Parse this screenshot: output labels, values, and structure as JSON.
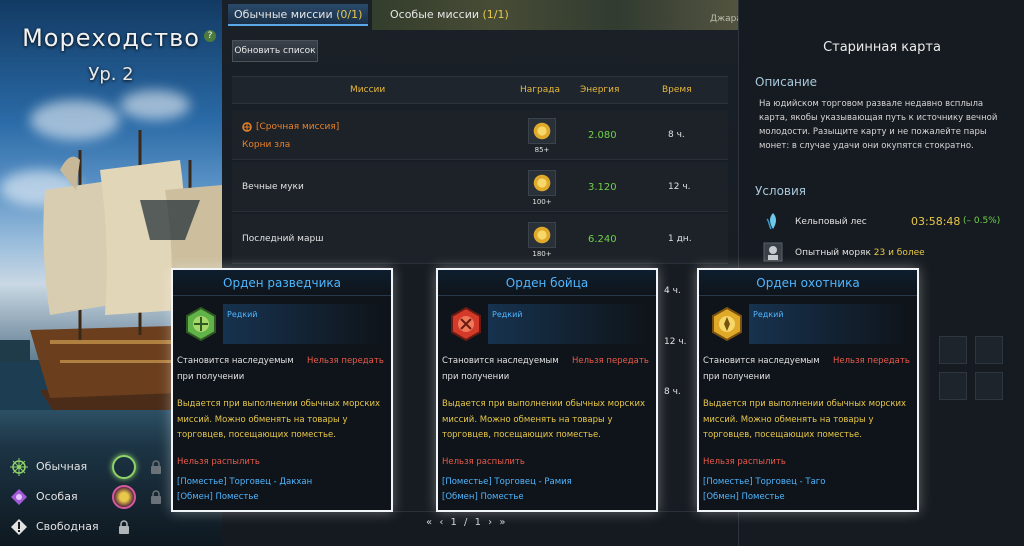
{
  "left": {
    "title": "Мореходство",
    "help": "?",
    "level": "Ур. 2",
    "modes": [
      {
        "label": "Обычная"
      },
      {
        "label": "Особая"
      },
      {
        "label": "Свободная"
      }
    ]
  },
  "tabs": [
    {
      "label": "Обычные миссии",
      "count": "(0/1)"
    },
    {
      "label": "Особые миссии",
      "count": "(1/1)"
    }
  ],
  "toolbar": {
    "refresh_label": "Обновить список"
  },
  "table": {
    "headers": [
      "Миссии",
      "Награда",
      "Энергия",
      "Время"
    ],
    "rows": [
      {
        "tag": "[Срочная миссия]",
        "name": "Корни зла",
        "reward_count": "85+",
        "energy": "2.080",
        "time": "8 ч."
      },
      {
        "tag": "",
        "name": "Вечные муки",
        "reward_count": "100+",
        "energy": "3.120",
        "time": "12 ч."
      },
      {
        "tag": "",
        "name": "Последний марш",
        "reward_count": "180+",
        "energy": "6.240",
        "time": "1 дн."
      }
    ],
    "hidden_times": [
      "4 ч.",
      "12 ч.",
      "8 ч."
    ]
  },
  "map_fragment": "Джарагай",
  "pager": {
    "page": "1 / 1",
    "first": "«",
    "prev": "‹",
    "next": "›",
    "last": "»"
  },
  "right": {
    "title": "Старинная карта",
    "desc_header": "Описание",
    "description": "На юдийском торговом развале недавно всплыла карта, якобы указывающая путь к источнику вечной молодости. Разыщите карту и не пожалейте пары монет: в случае удачи они окупятся стократно.",
    "cond_header": "Условия",
    "conditions": [
      {
        "label": "Кельповый лес",
        "timer": "03:58:48",
        "pct": "(– 0.5%)"
      },
      {
        "label": "Опытный моряк",
        "value": "23 и более"
      }
    ]
  },
  "tooltips": [
    {
      "title": "Орден разведчика",
      "rarity": "Редкий",
      "bind": "Становится наследуемым",
      "no_transfer": "Нельзя передать",
      "on_get": "при получении",
      "desc": "Выдается при выполнении обычных морских миссий. Можно обменять на товары у торговцев, посещающих поместье.",
      "no_disassemble": "Нельзя распылить",
      "estate": "[Поместье] Торговец - Дакхан",
      "exchange": "[Обмен] Поместье",
      "accent": "#62b24a"
    },
    {
      "title": "Орден бойца",
      "rarity": "Редкий",
      "bind": "Становится наследуемым",
      "no_transfer": "Нельзя передать",
      "on_get": "при получении",
      "desc": "Выдается при выполнении обычных морских миссий. Можно обменять на товары у торговцев, посещающих поместье.",
      "no_disassemble": "Нельзя распылить",
      "estate": "[Поместье] Торговец - Рамия",
      "exchange": "[Обмен] Поместье",
      "accent": "#d43a2a"
    },
    {
      "title": "Орден охотника",
      "rarity": "Редкий",
      "bind": "Становится наследуемым",
      "no_transfer": "Нельзя передать",
      "on_get": "при получении",
      "desc": "Выдается при выполнении обычных морских миссий. Можно обменять на товары у торговцев, посещающих поместье.",
      "no_disassemble": "Нельзя распылить",
      "estate": "[Поместье] Торговец - Таго",
      "exchange": "[Обмен] Поместье",
      "accent": "#e0a92a"
    }
  ],
  "colors": {
    "accent": "#4fb6ff",
    "gold": "#e7b83c",
    "energy": "#6fd04a",
    "warning": "#e85a4a"
  }
}
